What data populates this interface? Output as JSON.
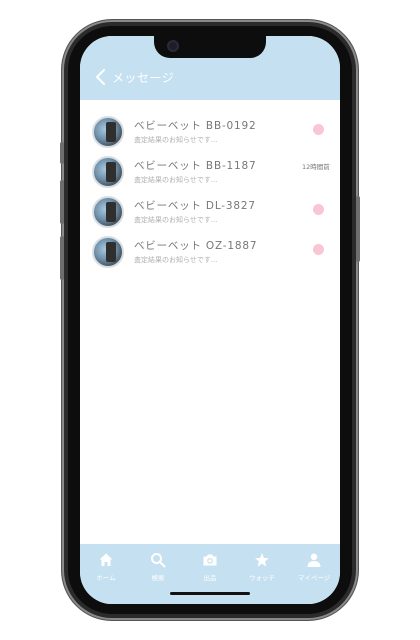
{
  "header": {
    "title": "メッセージ"
  },
  "messages": [
    {
      "name": "ベビーベット BB-0192",
      "preview": "査定結果のお知らせです...",
      "time": "",
      "unread": true
    },
    {
      "name": "ベビーベット BB-1187",
      "preview": "査定結果のお知らせです...",
      "time": "12時間前",
      "unread": false
    },
    {
      "name": "ベビーベット DL-3827",
      "preview": "査定結果のお知らせです...",
      "time": "",
      "unread": true
    },
    {
      "name": "ベビーベット OZ-1887",
      "preview": "査定結果のお知らせです...",
      "time": "",
      "unread": true
    }
  ],
  "nav": {
    "home": "ホーム",
    "search": "検索",
    "listing": "出品",
    "watch": "ウォッチ",
    "mypage": "マイページ"
  },
  "colors": {
    "accent": "#c5e0f0",
    "unread_dot": "#f9c6d3"
  },
  "icons": [
    "chevron-left-icon",
    "home-icon",
    "search-icon",
    "camera-icon",
    "star-icon",
    "person-icon"
  ]
}
